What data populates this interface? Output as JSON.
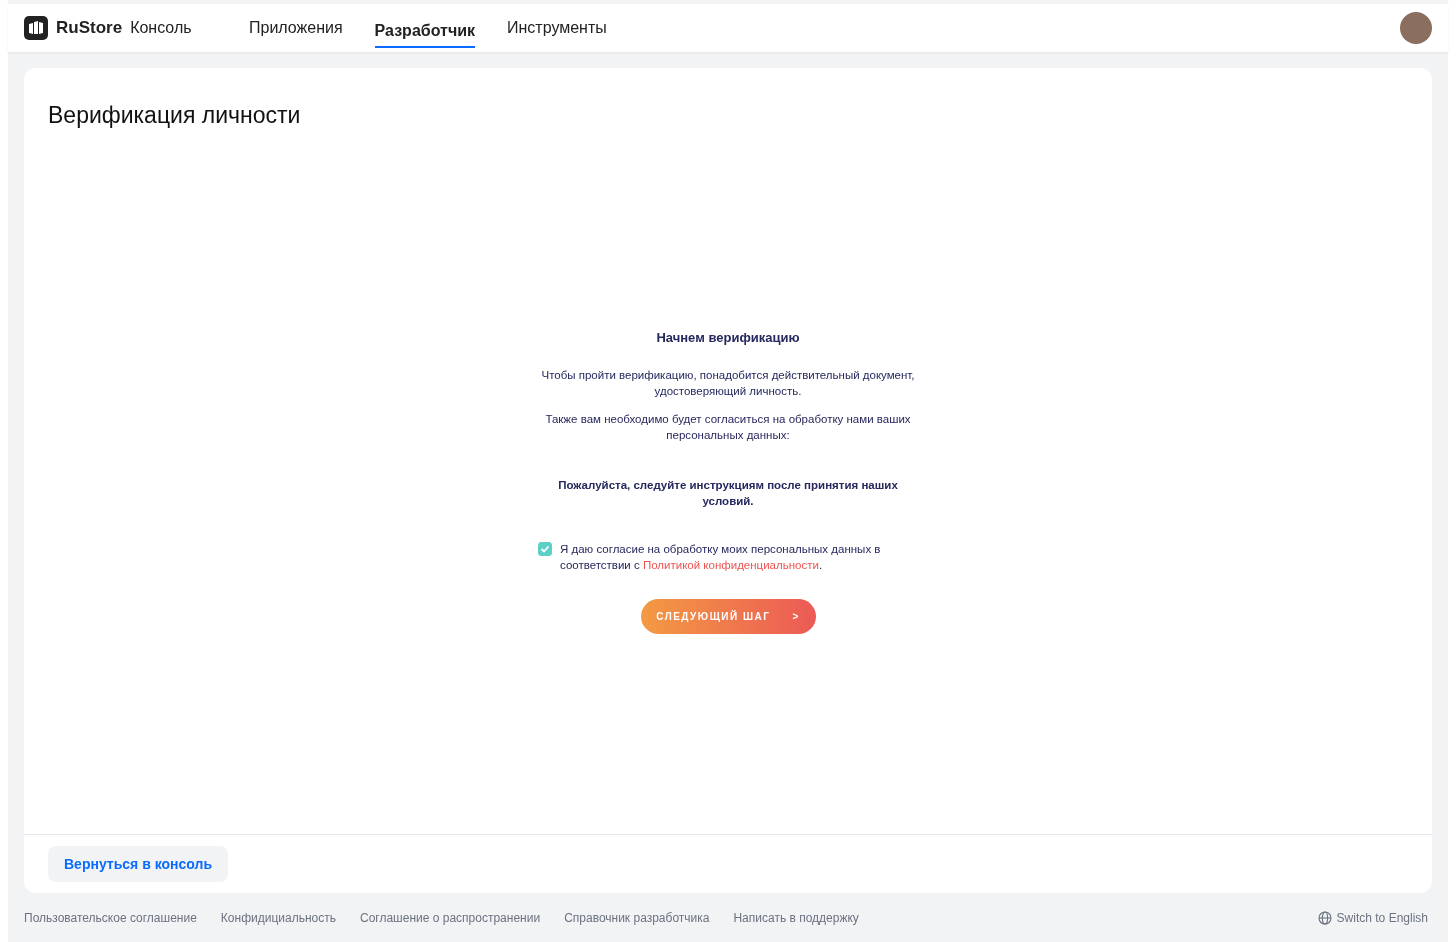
{
  "header": {
    "brand": "RuStore",
    "product": "Консоль",
    "tabs": [
      {
        "label": "Приложения",
        "selected": false
      },
      {
        "label": "Разработчик",
        "selected": true
      },
      {
        "label": "Инструменты",
        "selected": false
      }
    ]
  },
  "page": {
    "title": "Верификация личности",
    "heading": "Начнем верификацию",
    "paragraphs": [
      "Чтобы пройти верификацию, понадобится действительный документ, удостоверяющий личность.",
      "Также вам необходимо будет согласиться на обработку нами ваших персональных данных:"
    ],
    "instruction": "Пожалуйста, следуйте инструкциям после принятия наших условий.",
    "consent": {
      "checked": true,
      "text_before": "Я даю согласие на обработку моих персональных данных в соответствии с ",
      "link": "Политикой конфиденциальности",
      "text_after": "."
    },
    "next_button": {
      "label": "СЛЕДУЮЩИЙ ШАГ",
      "arrow": ">"
    },
    "back_button": "Вернуться в консоль"
  },
  "footer": {
    "links": [
      "Пользовательское соглашение",
      "Конфидициальность",
      "Соглашение о распространении",
      "Справочник разработчика",
      "Написать в поддержку"
    ],
    "language": "Switch to English"
  }
}
